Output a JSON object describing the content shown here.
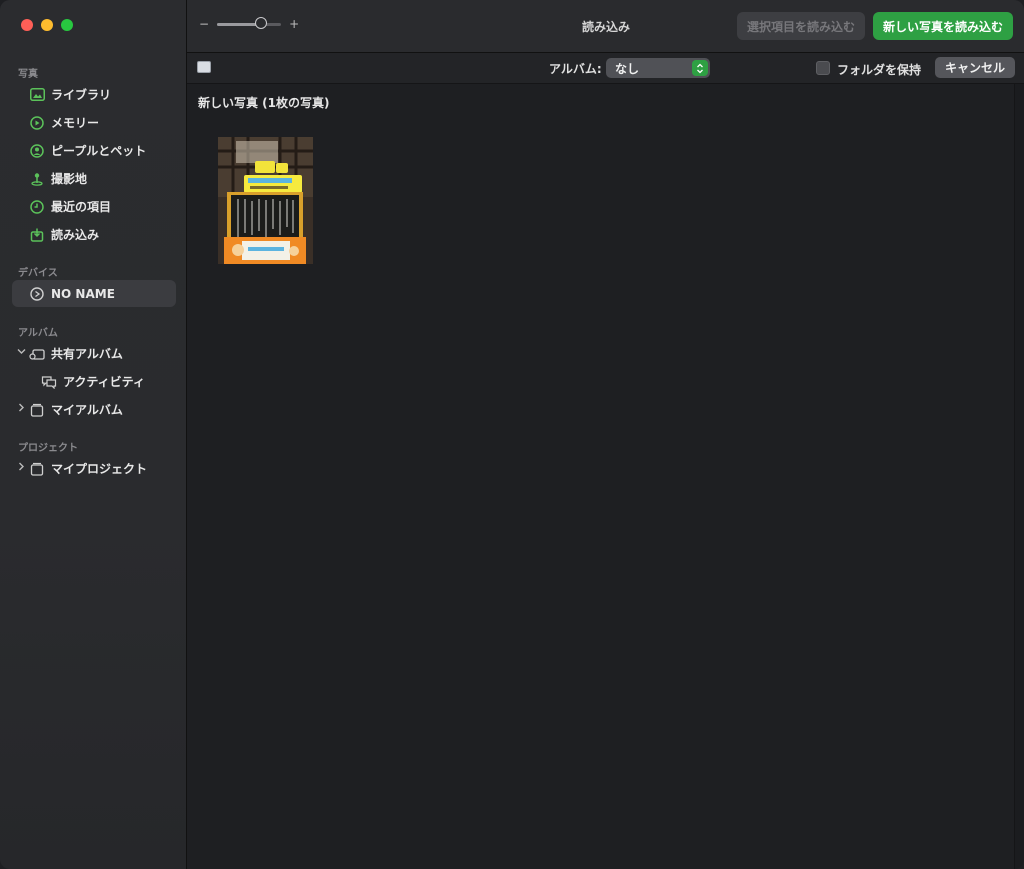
{
  "window": {
    "title": "読み込み"
  },
  "toolbar": {
    "zoom_minus": "−",
    "zoom_plus": "+",
    "zoom_level": 0.68,
    "import_selected_label": "選択項目を読み込む",
    "import_new_label": "新しい写真を読み込む"
  },
  "subbar": {
    "album_label": "アルバム:",
    "album_value": "なし",
    "keep_folders_label": "フォルダを保持",
    "keep_folders_checked": false,
    "cancel_label": "キャンセル"
  },
  "sidebar": {
    "photos_section": "写真",
    "items": [
      {
        "label": "ライブラリ",
        "icon": "photo-library-icon"
      },
      {
        "label": "メモリー",
        "icon": "memories-icon"
      },
      {
        "label": "ピープルとペット",
        "icon": "people-icon"
      },
      {
        "label": "撮影地",
        "icon": "places-icon"
      },
      {
        "label": "最近の項目",
        "icon": "recents-icon"
      },
      {
        "label": "読み込み",
        "icon": "imports-icon"
      }
    ],
    "devices_section": "デバイス",
    "device": {
      "label": "NO NAME",
      "icon": "disk-icon"
    },
    "albums_section": "アルバム",
    "shared_albums": "共有アルバム",
    "activity": "アクティビティ",
    "my_albums": "マイアルバム",
    "projects_section": "プロジェクト",
    "my_projects": "マイプロジェクト"
  },
  "main": {
    "heading": "新しい写真 (1枚の写真)"
  },
  "colors": {
    "accent": "#2ea043",
    "sidebar_icon": "#5bc25a"
  }
}
